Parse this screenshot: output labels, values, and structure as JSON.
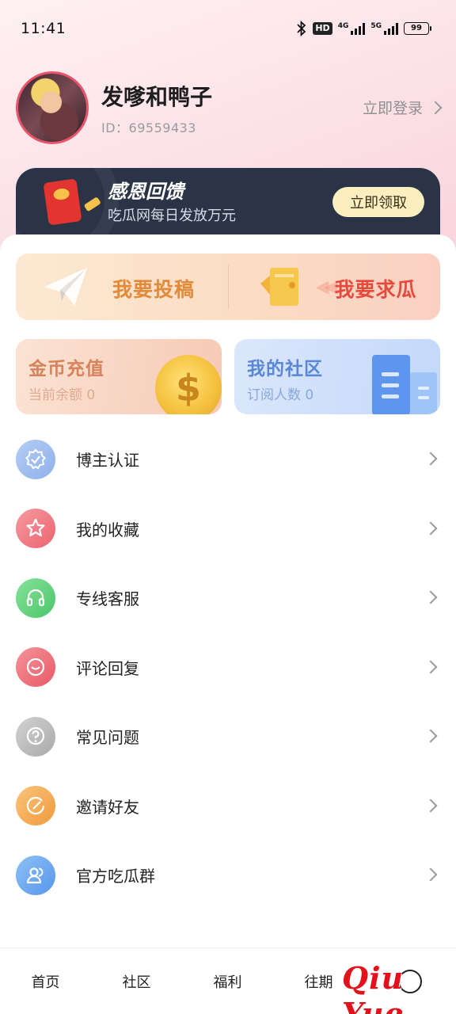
{
  "status_bar": {
    "time": "11:41",
    "hd_badge": "HD",
    "net1": "4G",
    "net2": "5G",
    "battery": "99"
  },
  "profile": {
    "username": "发嗲和鸭子",
    "user_id": "ID：69559433",
    "login_text": "立即登录"
  },
  "gift_banner": {
    "title": "感恩回馈",
    "subtitle": "吃瓜网每日发放万元",
    "button": "立即领取"
  },
  "actions": {
    "submit": "我要投稿",
    "request": "我要求瓜"
  },
  "cards": {
    "coin": {
      "title": "金币充值",
      "subtitle": "当前余额 0"
    },
    "community": {
      "title": "我的社区",
      "subtitle": "订阅人数 0"
    }
  },
  "menu": [
    {
      "label": "博主认证",
      "icon": "verified-badge-icon",
      "color": "#8fb4ec"
    },
    {
      "label": "我的收藏",
      "icon": "star-icon",
      "color": "#f0737c"
    },
    {
      "label": "专线客服",
      "icon": "headset-icon",
      "color": "#5fcf7a"
    },
    {
      "label": "评论回复",
      "icon": "smile-chat-icon",
      "color": "#ef6a72"
    },
    {
      "label": "常见问题",
      "icon": "question-icon",
      "color": "#b8b8b8"
    },
    {
      "label": "邀请好友",
      "icon": "invite-icon",
      "color": "#f5ad55"
    },
    {
      "label": "官方吃瓜群",
      "icon": "group-icon",
      "color": "#6aa6ee"
    }
  ],
  "bottom_nav": {
    "items": [
      "首页",
      "社区",
      "福利",
      "往期"
    ]
  },
  "watermark": "Qiu Yue",
  "colors": {
    "accent_red": "#e54a3c",
    "banner_dark": "#2b3446",
    "claim_button": "#fbeebf"
  }
}
